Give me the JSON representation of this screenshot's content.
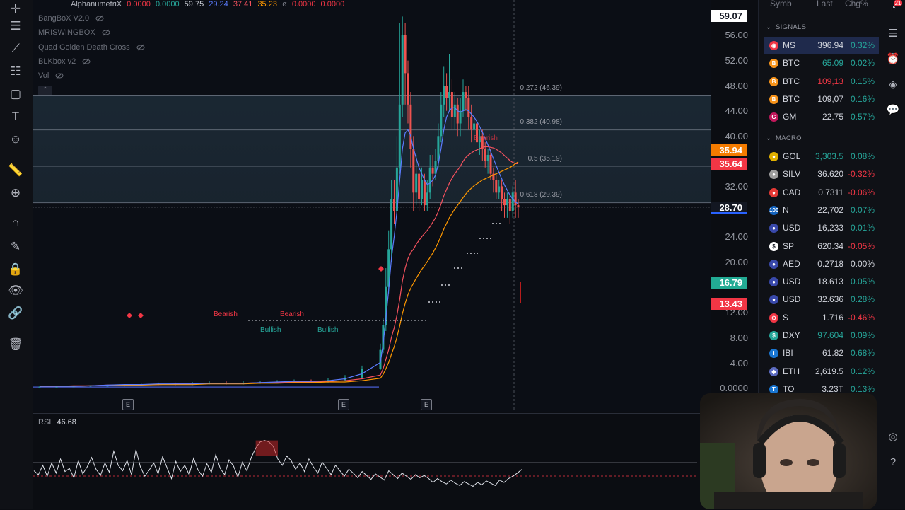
{
  "indicators": {
    "main": {
      "name": "AlphanumetriX",
      "values": [
        {
          "text": "0.0000",
          "color": "#f23645"
        },
        {
          "text": "0.0000",
          "color": "#26a69a"
        },
        {
          "text": "59.75",
          "color": "#d1d4dc"
        },
        {
          "text": "29.24",
          "color": "#5b7cff"
        },
        {
          "text": "37.41",
          "color": "#f7525f"
        },
        {
          "text": "35.23",
          "color": "#ff9800"
        },
        {
          "text": "ø",
          "color": "#787b86"
        },
        {
          "text": "0.0000",
          "color": "#f23645"
        },
        {
          "text": "0.0000",
          "color": "#f23645"
        }
      ]
    },
    "list": [
      "BangBoX V2.0",
      "MRISWINGBOX",
      "Quad Golden Death Cross",
      "BLKbox v2",
      "Vol"
    ]
  },
  "fib_levels": [
    {
      "label": "0.272 (46.39)"
    },
    {
      "label": "0.382 (40.98)"
    },
    {
      "label": "0.5 (35.19)"
    },
    {
      "label": "0.618 (29.39)"
    }
  ],
  "price_axis": {
    "ticks": [
      "56.00",
      "52.00",
      "48.00",
      "44.00",
      "40.00",
      "32.00",
      "24.00",
      "20.00",
      "12.00",
      "8.00",
      "4.00",
      "0.0000"
    ],
    "badges": [
      {
        "text": "59.07",
        "bg": "#ffffff",
        "fg": "#131722"
      },
      {
        "text": "35.94",
        "bg": "#f57c00",
        "fg": "#ffffff"
      },
      {
        "text": "35.64",
        "bg": "#f23645",
        "fg": "#ffffff"
      },
      {
        "text": "28.70",
        "bg": "#131722",
        "fg": "#ffffff"
      },
      {
        "text": "16.79",
        "bg": "#22ab94",
        "fg": "#ffffff"
      },
      {
        "text": "13.43",
        "bg": "#f23645",
        "fg": "#ffffff"
      }
    ]
  },
  "patterns": {
    "bearish": [
      "Bearish",
      "Bearish",
      "Bearish"
    ],
    "bullish": [
      "Bullish",
      "Bullish"
    ]
  },
  "e_markers": [
    "E",
    "E",
    "E"
  ],
  "rsi": {
    "label": "RSI",
    "value": "46.68"
  },
  "watchlist": {
    "headers": {
      "symbol": "Symb",
      "last": "Last",
      "chg": "Chg%"
    },
    "sections": [
      "SIGNALS",
      "MACRO"
    ],
    "signals": [
      {
        "sym": "MS",
        "last": "396.94",
        "chg": "0.32%",
        "last_color": "#d1d4dc",
        "chg_color": "#26a69a",
        "icon_color": "#f23645",
        "icon": "◉",
        "active": true
      },
      {
        "sym": "BTC",
        "last": "65.09",
        "chg": "0.02%",
        "last_color": "#26a69a",
        "chg_color": "#26a69a",
        "icon_color": "#f7931a",
        "icon": "B"
      },
      {
        "sym": "BTC",
        "last": "109,13",
        "chg": "0.15%",
        "last_color": "#f23645",
        "chg_color": "#26a69a",
        "icon_color": "#f7931a",
        "icon": "B"
      },
      {
        "sym": "BTC",
        "last": "109,07",
        "chg": "0.16%",
        "last_color": "#d1d4dc",
        "chg_color": "#26a69a",
        "icon_color": "#f7931a",
        "icon": "B"
      },
      {
        "sym": "GM",
        "last": "22.75",
        "chg": "0.57%",
        "last_color": "#d1d4dc",
        "chg_color": "#26a69a",
        "icon_color": "#c2185b",
        "icon": "G"
      }
    ],
    "macro": [
      {
        "sym": "GOL",
        "last": "3,303.5",
        "chg": "0.08%",
        "last_color": "#26a69a",
        "chg_color": "#26a69a",
        "icon_color": "#e0b000",
        "icon": "●"
      },
      {
        "sym": "SILV",
        "last": "36.620",
        "chg": "-0.32%",
        "last_color": "#d1d4dc",
        "chg_color": "#f23645",
        "icon_color": "#9e9e9e",
        "icon": "●"
      },
      {
        "sym": "CAD",
        "last": "0.7311",
        "chg": "-0.06%",
        "last_color": "#d1d4dc",
        "chg_color": "#f23645",
        "icon_color": "#e53935",
        "icon": "●"
      },
      {
        "sym": "N",
        "last": "22,702",
        "chg": "0.07%",
        "last_color": "#d1d4dc",
        "chg_color": "#26a69a",
        "icon_color": "#1565c0",
        "icon": "100"
      },
      {
        "sym": "USD",
        "last": "16,233",
        "chg": "0.01%",
        "last_color": "#d1d4dc",
        "chg_color": "#26a69a",
        "icon_color": "#3949ab",
        "icon": "●"
      },
      {
        "sym": "SP",
        "last": "620.34",
        "chg": "-0.05%",
        "last_color": "#d1d4dc",
        "chg_color": "#f23645",
        "icon_color": "#ffffff",
        "icon": "$"
      },
      {
        "sym": "AED",
        "last": "0.2718",
        "chg": "0.00%",
        "last_color": "#d1d4dc",
        "chg_color": "#d1d4dc",
        "icon_color": "#3949ab",
        "icon": "●"
      },
      {
        "sym": "USD",
        "last": "18.613",
        "chg": "0.05%",
        "last_color": "#d1d4dc",
        "chg_color": "#26a69a",
        "icon_color": "#3949ab",
        "icon": "●"
      },
      {
        "sym": "USD",
        "last": "32.636",
        "chg": "0.28%",
        "last_color": "#d1d4dc",
        "chg_color": "#26a69a",
        "icon_color": "#3949ab",
        "icon": "●"
      },
      {
        "sym": "S",
        "last": "1.716",
        "chg": "-0.46%",
        "last_color": "#d1d4dc",
        "chg_color": "#f23645",
        "icon_color": "#f23645",
        "icon": "⊙"
      },
      {
        "sym": "DXY",
        "last": "97.604",
        "chg": "0.09%",
        "last_color": "#26a69a",
        "chg_color": "#26a69a",
        "icon_color": "#26a69a",
        "icon": "$"
      },
      {
        "sym": "IBI",
        "last": "61.82",
        "chg": "0.68%",
        "last_color": "#d1d4dc",
        "chg_color": "#26a69a",
        "icon_color": "#1976d2",
        "icon": "i"
      },
      {
        "sym": "ETH",
        "last": "2,619.5",
        "chg": "0.12%",
        "last_color": "#d1d4dc",
        "chg_color": "#26a69a",
        "icon_color": "#5c6bc0",
        "icon": "◆"
      },
      {
        "sym": "TO",
        "last": "3.23T",
        "chg": "0.13%",
        "last_color": "#d1d4dc",
        "chg_color": "#26a69a",
        "icon_color": "#1976d2",
        "icon": "T"
      }
    ]
  },
  "notification_count": "21",
  "chart_data": {
    "type": "candlestick",
    "title": "",
    "ylim": [
      0,
      59.07
    ],
    "last_price": 28.7,
    "fib_retracements": [
      46.39,
      40.98,
      35.19,
      29.39
    ],
    "candles": [
      [
        0.15,
        0.15,
        0.1,
        0.2
      ],
      [
        0.15,
        0.15,
        0.1,
        0.2
      ],
      [
        0.2,
        0.2,
        0.1,
        0.25
      ],
      [
        0.2,
        0.3,
        0.15,
        0.4
      ],
      [
        0.3,
        0.3,
        0.2,
        0.4
      ],
      [
        0.3,
        0.4,
        0.2,
        0.5
      ],
      [
        0.4,
        0.5,
        0.3,
        0.6
      ],
      [
        0.5,
        0.6,
        0.4,
        0.8
      ],
      [
        0.6,
        0.5,
        0.4,
        0.8
      ],
      [
        0.5,
        0.6,
        0.4,
        0.9
      ],
      [
        0.6,
        0.7,
        0.5,
        1.0
      ],
      [
        0.7,
        0.6,
        0.5,
        1.0
      ],
      [
        0.6,
        0.7,
        0.5,
        1.1
      ],
      [
        0.7,
        0.8,
        0.6,
        1.1
      ],
      [
        0.8,
        0.9,
        0.7,
        1.2
      ],
      [
        0.9,
        1.0,
        0.8,
        1.3
      ],
      [
        1.0,
        0.9,
        0.8,
        1.3
      ],
      [
        0.9,
        1.2,
        0.8,
        1.5
      ],
      [
        1.2,
        1.6,
        1.1,
        2.0
      ],
      [
        1.6,
        3.0,
        1.5,
        3.5
      ],
      [
        3.0,
        6.0,
        2.8,
        7.0
      ],
      [
        6.0,
        10.0,
        5.5,
        11.0
      ],
      [
        10.0,
        16.0,
        9.0,
        19.0
      ],
      [
        16.0,
        22.0,
        15.0,
        25.0
      ],
      [
        22.0,
        30.0,
        20.0,
        33.0
      ],
      [
        30.0,
        28.0,
        26.0,
        33.0
      ],
      [
        28.0,
        35.0,
        27.0,
        40.0
      ],
      [
        35.0,
        45.0,
        34.0,
        58.0
      ],
      [
        45.0,
        56.0,
        43.0,
        59.0
      ],
      [
        56.0,
        50.0,
        45.0,
        58.0
      ],
      [
        50.0,
        45.0,
        42.0,
        52.0
      ],
      [
        45.0,
        38.0,
        35.0,
        47.0
      ],
      [
        38.0,
        31.0,
        28.0,
        40.0
      ],
      [
        31.0,
        34.0,
        29.0,
        37.0
      ],
      [
        34.0,
        30.0,
        28.0,
        36.0
      ],
      [
        30.0,
        33.0,
        29.0,
        35.0
      ],
      [
        33.0,
        29.0,
        28.0,
        34.0
      ],
      [
        29.0,
        31.0,
        28.0,
        33.0
      ],
      [
        31.0,
        35.0,
        30.0,
        37.0
      ],
      [
        35.0,
        34.0,
        32.0,
        37.0
      ],
      [
        34.0,
        36.0,
        33.0,
        38.0
      ],
      [
        36.0,
        40.0,
        35.0,
        42.0
      ],
      [
        40.0,
        45.0,
        39.0,
        47.0
      ],
      [
        45.0,
        48.0,
        43.0,
        51.0
      ],
      [
        48.0,
        46.0,
        44.0,
        50.0
      ],
      [
        46.0,
        47.0,
        44.0,
        53.0
      ],
      [
        47.0,
        43.0,
        41.0,
        49.0
      ],
      [
        43.0,
        45.0,
        41.0,
        47.0
      ],
      [
        45.0,
        42.0,
        40.0,
        46.0
      ],
      [
        42.0,
        44.0,
        40.0,
        46.0
      ],
      [
        44.0,
        47.0,
        43.0,
        49.0
      ],
      [
        47.0,
        46.0,
        44.0,
        48.0
      ],
      [
        46.0,
        43.0,
        41.0,
        48.0
      ],
      [
        43.0,
        41.0,
        39.0,
        45.0
      ],
      [
        41.0,
        42.0,
        39.0,
        43.0
      ],
      [
        42.0,
        39.0,
        38.0,
        43.0
      ],
      [
        39.0,
        40.0,
        37.0,
        41.0
      ],
      [
        40.0,
        38.0,
        36.0,
        41.0
      ],
      [
        38.0,
        36.0,
        35.0,
        39.0
      ],
      [
        36.0,
        37.0,
        34.0,
        38.0
      ],
      [
        37.0,
        34.0,
        33.0,
        38.0
      ],
      [
        34.0,
        33.0,
        31.0,
        35.0
      ],
      [
        33.0,
        31.0,
        30.0,
        34.0
      ],
      [
        31.0,
        32.0,
        30.0,
        33.0
      ],
      [
        32.0,
        30.0,
        28.0,
        33.0
      ],
      [
        30.0,
        29.0,
        27.0,
        31.0
      ],
      [
        29.0,
        30.0,
        27.0,
        31.0
      ],
      [
        30.0,
        28.0,
        26.0,
        31.0
      ],
      [
        28.0,
        31.0,
        27.0,
        32.0
      ],
      [
        31.0,
        29.0,
        27.0,
        33.0
      ],
      [
        29.0,
        28.7,
        27.0,
        30.0
      ]
    ],
    "ma_red": [
      0.2,
      0.2,
      0.3,
      0.3,
      0.4,
      0.4,
      0.5,
      0.5,
      0.6,
      0.6,
      0.7,
      0.7,
      0.7,
      0.8,
      0.8,
      0.9,
      0.9,
      1.0,
      1.1,
      1.4,
      2.0,
      3.0,
      4.5,
      6.0,
      8.0,
      9.5,
      11.5,
      14.0,
      17.0,
      19.0,
      20.5,
      21.5,
      22.0,
      22.8,
      23.4,
      24.0,
      24.5,
      25.0,
      25.6,
      26.3,
      27.0,
      28.0,
      29.2,
      30.5,
      31.5,
      32.5,
      33.3,
      34.0,
      34.6,
      35.2,
      36.0,
      36.6,
      37.0,
      37.3,
      37.6,
      37.8,
      38.0,
      38.2,
      38.3,
      38.3,
      38.2,
      38.1,
      37.9,
      37.6,
      37.3,
      36.9,
      36.5,
      36.1,
      35.8,
      35.6,
      35.6
    ],
    "ma_orange": [
      0.2,
      0.2,
      0.2,
      0.3,
      0.3,
      0.4,
      0.4,
      0.5,
      0.5,
      0.5,
      0.6,
      0.6,
      0.6,
      0.7,
      0.7,
      0.8,
      0.8,
      0.9,
      0.9,
      1.1,
      1.5,
      2.1,
      3.0,
      4.0,
      5.3,
      6.5,
      8.0,
      9.8,
      11.8,
      13.4,
      14.8,
      15.8,
      16.6,
      17.4,
      18.1,
      18.8,
      19.4,
      20.0,
      20.7,
      21.4,
      22.2,
      23.1,
      24.1,
      25.2,
      26.1,
      27.0,
      27.7,
      28.4,
      29.0,
      29.6,
      30.2,
      30.8,
      31.3,
      31.7,
      32.1,
      32.4,
      32.7,
      33.0,
      33.2,
      33.4,
      33.6,
      33.8,
      34.0,
      34.2,
      34.4,
      34.6,
      34.8,
      35.0,
      35.3,
      35.6,
      35.9
    ],
    "ma_blue": [
      0.2,
      0.2,
      0.2,
      0.3,
      0.4,
      0.5,
      0.5,
      0.6,
      0.6,
      0.6,
      0.7,
      0.7,
      0.7,
      0.8,
      0.9,
      1.0,
      1.0,
      1.1,
      1.4,
      2.2,
      4.0,
      7.0,
      11.0,
      15.5,
      20.5,
      24.0,
      28.0,
      33.0,
      38.0,
      40.5,
      41.0,
      40.0,
      38.0,
      36.5,
      35.0,
      34.0,
      33.0,
      32.3,
      32.5,
      33.0,
      33.8,
      35.5,
      38.0,
      41.0,
      43.0,
      44.0,
      44.5,
      44.5,
      44.0,
      43.8,
      44.0,
      44.2,
      44.0,
      43.5,
      43.0,
      42.3,
      41.5,
      40.6,
      39.6,
      38.6,
      37.5,
      36.4,
      35.3,
      34.2,
      33.2,
      32.2,
      31.4,
      30.6,
      30.0,
      29.5,
      29.2
    ],
    "rsi": [
      45,
      40,
      52,
      38,
      55,
      42,
      60,
      44,
      48,
      36,
      58,
      41,
      50,
      62,
      47,
      39,
      55,
      43,
      70,
      52,
      45,
      58,
      40,
      72,
      50,
      38,
      46,
      55,
      41,
      63,
      49,
      35,
      57,
      44,
      52,
      40,
      61,
      46,
      38,
      54,
      43,
      66,
      48,
      40,
      59,
      51,
      37,
      56,
      45,
      62,
      74,
      82,
      84,
      82,
      76,
      60,
      52,
      64,
      58,
      47,
      55,
      44,
      60,
      50,
      42,
      56,
      48,
      40,
      52,
      45,
      38,
      47,
      42,
      36,
      44,
      39,
      34,
      41,
      37,
      33,
      45,
      40,
      35,
      42,
      38,
      34,
      40,
      36,
      39,
      35,
      30,
      35,
      31,
      28,
      33,
      29,
      26,
      31,
      28,
      25,
      30,
      27,
      32,
      29,
      26,
      33,
      30,
      35,
      38,
      42,
      46.68
    ]
  }
}
